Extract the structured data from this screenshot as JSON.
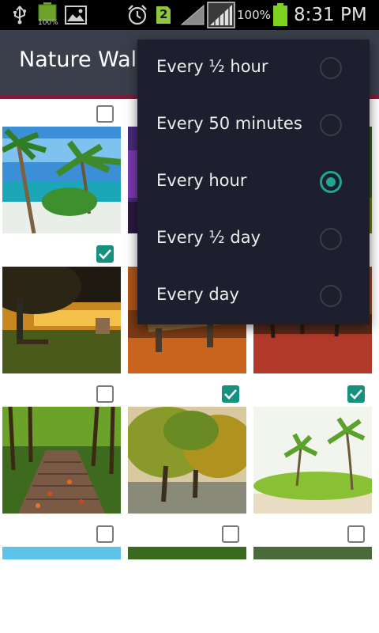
{
  "status_bar": {
    "time": "8:31 PM",
    "battery_percent": "100%",
    "notification_count": "2",
    "mini_battery_label": "100%",
    "icons": [
      "usb-icon",
      "battery-small-icon",
      "image-icon",
      "alarm-icon",
      "sim-icon",
      "signal-icon",
      "signal-full-icon",
      "battery-icon"
    ]
  },
  "app_bar": {
    "title": "Nature Wal"
  },
  "popup": {
    "options": [
      {
        "label": "Every ½ hour",
        "selected": false
      },
      {
        "label": "Every 50 minutes",
        "selected": false
      },
      {
        "label": "Every hour",
        "selected": true
      },
      {
        "label": "Every ½ day",
        "selected": false
      },
      {
        "label": "Every day",
        "selected": false
      }
    ]
  },
  "grid": {
    "items": [
      {
        "checked": false,
        "scene": "tropical-beach"
      },
      {
        "checked": false,
        "scene": "purple-sky"
      },
      {
        "checked": false,
        "scene": "forest"
      },
      {
        "checked": true,
        "scene": "swing-sunset"
      },
      {
        "checked": false,
        "scene": "autumn-bench"
      },
      {
        "checked": false,
        "scene": "autumn-path"
      },
      {
        "checked": false,
        "scene": "boardwalk"
      },
      {
        "checked": true,
        "scene": "autumn-trees"
      },
      {
        "checked": true,
        "scene": "palm-beach"
      },
      {
        "checked": false,
        "scene": "sky-lake"
      },
      {
        "checked": false,
        "scene": "green-woods"
      },
      {
        "checked": false,
        "scene": "trees"
      }
    ]
  },
  "colors": {
    "accent": "#1fa592",
    "app_bar": "#3a3f4b",
    "popup_bg": "#1e1f2e",
    "checkbox_on": "#16907f"
  }
}
